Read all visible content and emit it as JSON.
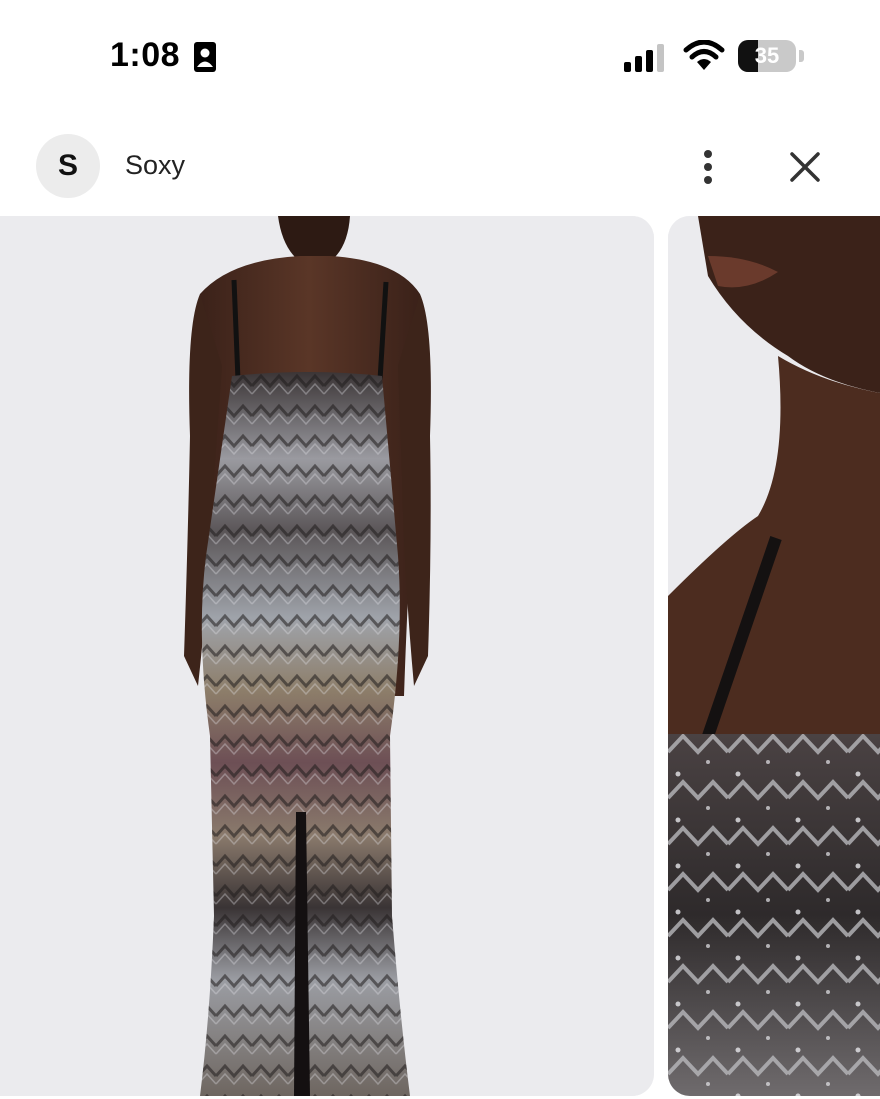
{
  "status_bar": {
    "time": "1:08",
    "contact_icon": "contact-card-icon",
    "signal_icon": "cellular-signal-icon",
    "wifi_icon": "wifi-icon",
    "battery_level": "35",
    "battery_fraction": 0.35
  },
  "header": {
    "avatar_letter": "S",
    "site_name": "Soxy",
    "more_icon": "more-vertical-icon",
    "close_icon": "close-icon"
  },
  "carousel": {
    "images": [
      {
        "alt": "dress-back-view"
      },
      {
        "alt": "dress-neckline-closeup"
      }
    ]
  },
  "colors": {
    "background": "#ffffff",
    "card_background": "#ebebee",
    "skin": "#4a2c20",
    "sequin_dark": "#2e2a2b",
    "sequin_light": "#b8b8bc",
    "sequin_mauve": "#6d4f55",
    "sequin_tan": "#8d7e6a"
  }
}
